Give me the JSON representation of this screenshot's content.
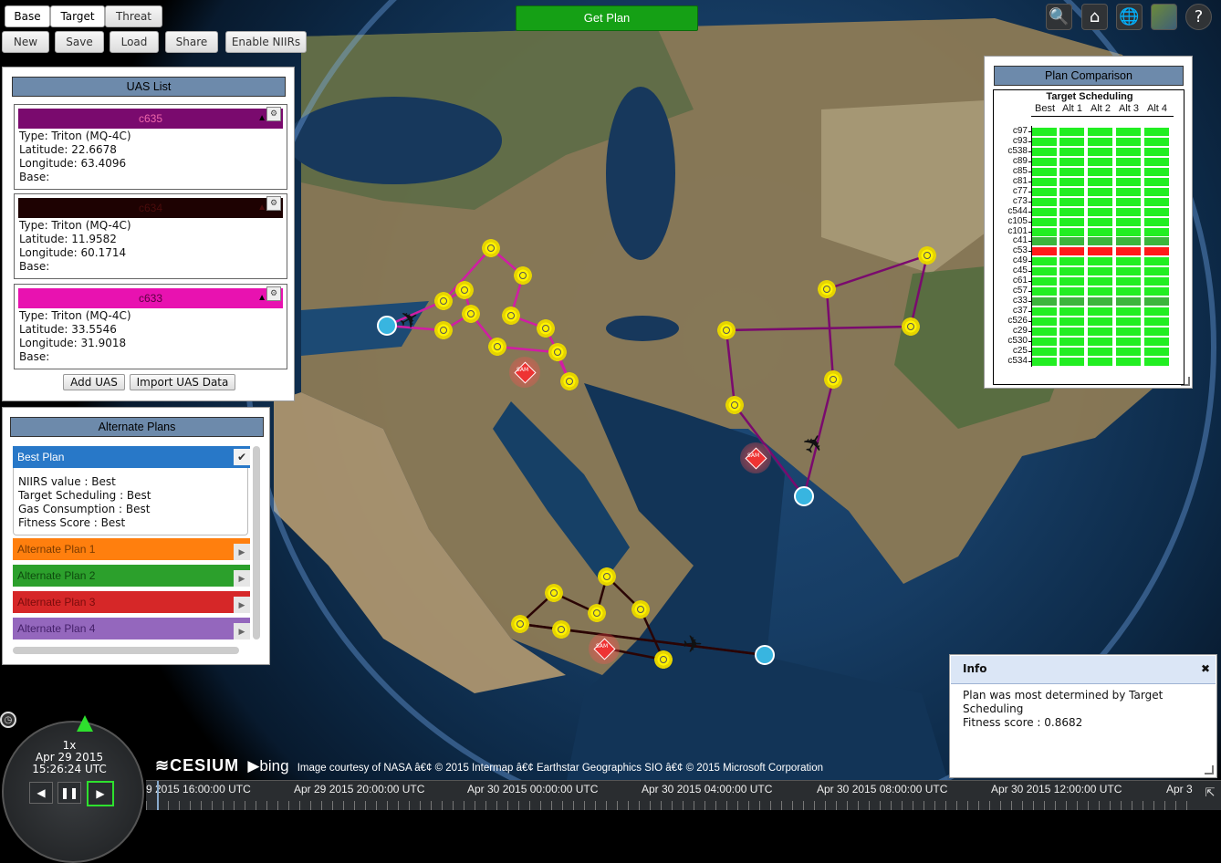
{
  "toolbar": {
    "tabs": [
      "Base",
      "Target",
      "Threat"
    ],
    "actions": [
      "New",
      "Save",
      "Load",
      "Share",
      "Enable NIIRs"
    ],
    "get_plan": "Get Plan"
  },
  "top_icons": [
    "search-icon",
    "home-icon",
    "globe-icon",
    "imagery-icon",
    "help-icon"
  ],
  "uas_list": {
    "title": "UAS List",
    "items": [
      {
        "name": "c635",
        "color": "#7a0a6e",
        "type": "Type: Triton (MQ-4C)",
        "lat": "Latitude: 22.6678",
        "lon": "Longitude: 63.4096",
        "base": "Base:"
      },
      {
        "name": "c634",
        "color": "#1e0202",
        "type": "Type: Triton (MQ-4C)",
        "lat": "Latitude: 11.9582",
        "lon": "Longitude: 60.1714",
        "base": "Base:"
      },
      {
        "name": "c633",
        "color": "#e812b0",
        "type": "Type: Triton (MQ-4C)",
        "lat": "Latitude: 33.5546",
        "lon": "Longitude: 31.9018",
        "base": "Base:"
      }
    ],
    "add_uas": "Add UAS",
    "import_uas": "Import UAS Data"
  },
  "alternate_plans": {
    "title": "Alternate Plans",
    "best": {
      "label": "Best Plan",
      "niirs": "NIIRS value : Best",
      "scheduling": "Target Scheduling : Best",
      "gas": "Gas Consumption : Best",
      "fitness": "Fitness Score : Best"
    },
    "alts": [
      {
        "label": "Alternate Plan 1",
        "color": "#ff7f0e"
      },
      {
        "label": "Alternate Plan 2",
        "color": "#2ca02c"
      },
      {
        "label": "Alternate Plan 3",
        "color": "#d62728"
      },
      {
        "label": "Alternate Plan 4",
        "color": "#9467bd"
      }
    ]
  },
  "plan_comparison": {
    "title": "Plan Comparison",
    "subtitle": "Target Scheduling",
    "columns": [
      "Best",
      "Alt 1",
      "Alt 2",
      "Alt 3",
      "Alt 4"
    ],
    "rows": [
      "c97",
      "c93",
      "c538",
      "c89",
      "c85",
      "c81",
      "c77",
      "c73",
      "c544",
      "c105",
      "c101",
      "c41",
      "c53",
      "c49",
      "c45",
      "c61",
      "c57",
      "c33",
      "c37",
      "c526",
      "c29",
      "c530",
      "c25",
      "c534"
    ],
    "row_status": [
      "ok",
      "ok",
      "ok",
      "ok",
      "ok",
      "ok",
      "ok",
      "ok",
      "ok",
      "ok",
      "ok",
      "partial",
      "fail",
      "ok",
      "ok",
      "ok",
      "ok",
      "partial",
      "ok",
      "ok",
      "ok",
      "ok",
      "ok",
      "ok"
    ],
    "colors": {
      "ok": "#22ee22",
      "partial": "#3cb53c",
      "fail": "#ff1a1a"
    }
  },
  "info": {
    "title": "Info",
    "close": "✖",
    "message": "Plan was most determined by Target Scheduling",
    "fitness": "Fitness score : 0.8682"
  },
  "clock": {
    "speed": "1x",
    "date": "Apr 29 2015",
    "time": "15:26:24 UTC"
  },
  "timeline": {
    "ticks": [
      "9 2015 16:00:00 UTC",
      "Apr 29 2015 20:00:00 UTC",
      "Apr 30 2015 00:00:00 UTC",
      "Apr 30 2015 04:00:00 UTC",
      "Apr 30 2015 08:00:00 UTC",
      "Apr 30 2015 12:00:00 UTC",
      "Apr 3"
    ]
  },
  "credits": {
    "cesium": "CESIUM",
    "bing": "bing",
    "text": "Image courtesy of NASA â€¢ © 2015 Intermap â€¢ Earthstar Geographics SIO â€¢ © 2015 Microsoft Corporation"
  },
  "map_labels": {
    "sam": "SAM"
  }
}
